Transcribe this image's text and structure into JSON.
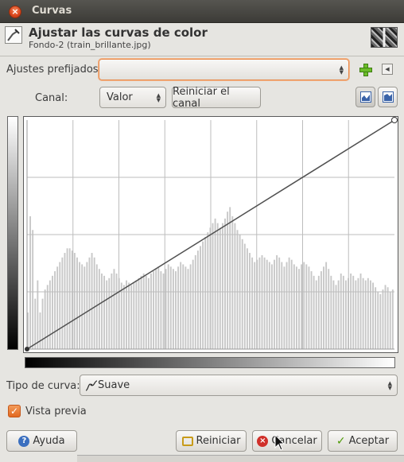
{
  "window": {
    "title": "Curvas"
  },
  "header": {
    "title": "Ajustar las curvas de color",
    "subtitle": "Fondo-2 (train_brillante.jpg)"
  },
  "presets": {
    "label": "Ajustes prefijados:",
    "value": ""
  },
  "channel": {
    "label": "Canal:",
    "value": "Valor",
    "reset_label": "Reiniciar el canal"
  },
  "curve_type": {
    "label": "Tipo de curva:",
    "value": "Suave"
  },
  "preview": {
    "label": "Vista previa",
    "checked": true
  },
  "buttons": {
    "help": "Ayuda",
    "reset": "Reiniciar",
    "cancel": "Cancelar",
    "ok": "Aceptar"
  },
  "histogram": [
    0.16,
    0.58,
    0.52,
    0.22,
    0.3,
    0.16,
    0.22,
    0.26,
    0.28,
    0.3,
    0.32,
    0.34,
    0.36,
    0.38,
    0.4,
    0.42,
    0.44,
    0.44,
    0.43,
    0.42,
    0.4,
    0.38,
    0.37,
    0.36,
    0.38,
    0.4,
    0.42,
    0.4,
    0.37,
    0.35,
    0.33,
    0.32,
    0.3,
    0.31,
    0.33,
    0.35,
    0.33,
    0.31,
    0.29,
    0.28,
    0.3,
    0.29,
    0.28,
    0.29,
    0.3,
    0.31,
    0.32,
    0.33,
    0.32,
    0.31,
    0.33,
    0.34,
    0.35,
    0.36,
    0.34,
    0.33,
    0.35,
    0.37,
    0.36,
    0.35,
    0.34,
    0.36,
    0.38,
    0.37,
    0.36,
    0.35,
    0.37,
    0.39,
    0.41,
    0.43,
    0.45,
    0.47,
    0.49,
    0.51,
    0.53,
    0.55,
    0.57,
    0.55,
    0.53,
    0.55,
    0.57,
    0.6,
    0.62,
    0.58,
    0.55,
    0.52,
    0.5,
    0.48,
    0.46,
    0.44,
    0.42,
    0.4,
    0.38,
    0.39,
    0.4,
    0.41,
    0.4,
    0.39,
    0.38,
    0.37,
    0.39,
    0.41,
    0.4,
    0.38,
    0.36,
    0.38,
    0.4,
    0.39,
    0.37,
    0.36,
    0.35,
    0.37,
    0.38,
    0.37,
    0.36,
    0.34,
    0.32,
    0.3,
    0.32,
    0.34,
    0.36,
    0.38,
    0.35,
    0.32,
    0.3,
    0.28,
    0.3,
    0.33,
    0.32,
    0.3,
    0.31,
    0.33,
    0.32,
    0.3,
    0.31,
    0.33,
    0.31,
    0.3,
    0.31,
    0.3,
    0.29,
    0.27,
    0.25,
    0.24,
    0.26,
    0.28,
    0.27,
    0.25,
    0.26
  ],
  "colors": {
    "accent": "#e98a4a",
    "titlebar": "#3c3b37",
    "histogram": "#c8c8c8",
    "curve": "#505050"
  }
}
